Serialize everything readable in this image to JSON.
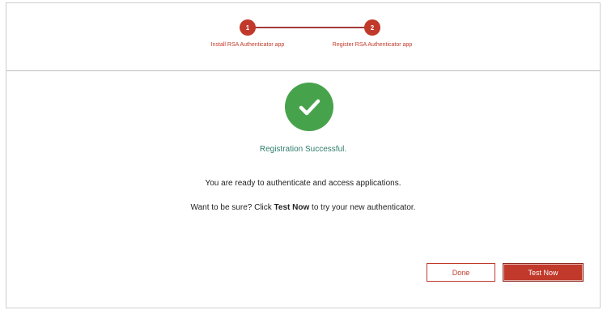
{
  "stepper": {
    "step1": {
      "number": "1",
      "label": "Install RSA Authenticator app"
    },
    "step2": {
      "number": "2",
      "label": "Register RSA Authenticator app"
    }
  },
  "status": {
    "title": "Registration Successful.",
    "message": "You are ready to authenticate and access applications.",
    "test_prefix": "Want to be sure? Click ",
    "test_bold": "Test Now",
    "test_suffix": " to try your new authenticator."
  },
  "buttons": {
    "done": "Done",
    "test_now": "Test Now"
  },
  "colors": {
    "accent": "#c0392b",
    "success": "#47a34b",
    "success_text": "#2e7d6b"
  },
  "icons": {
    "status": "check-circle-icon"
  }
}
